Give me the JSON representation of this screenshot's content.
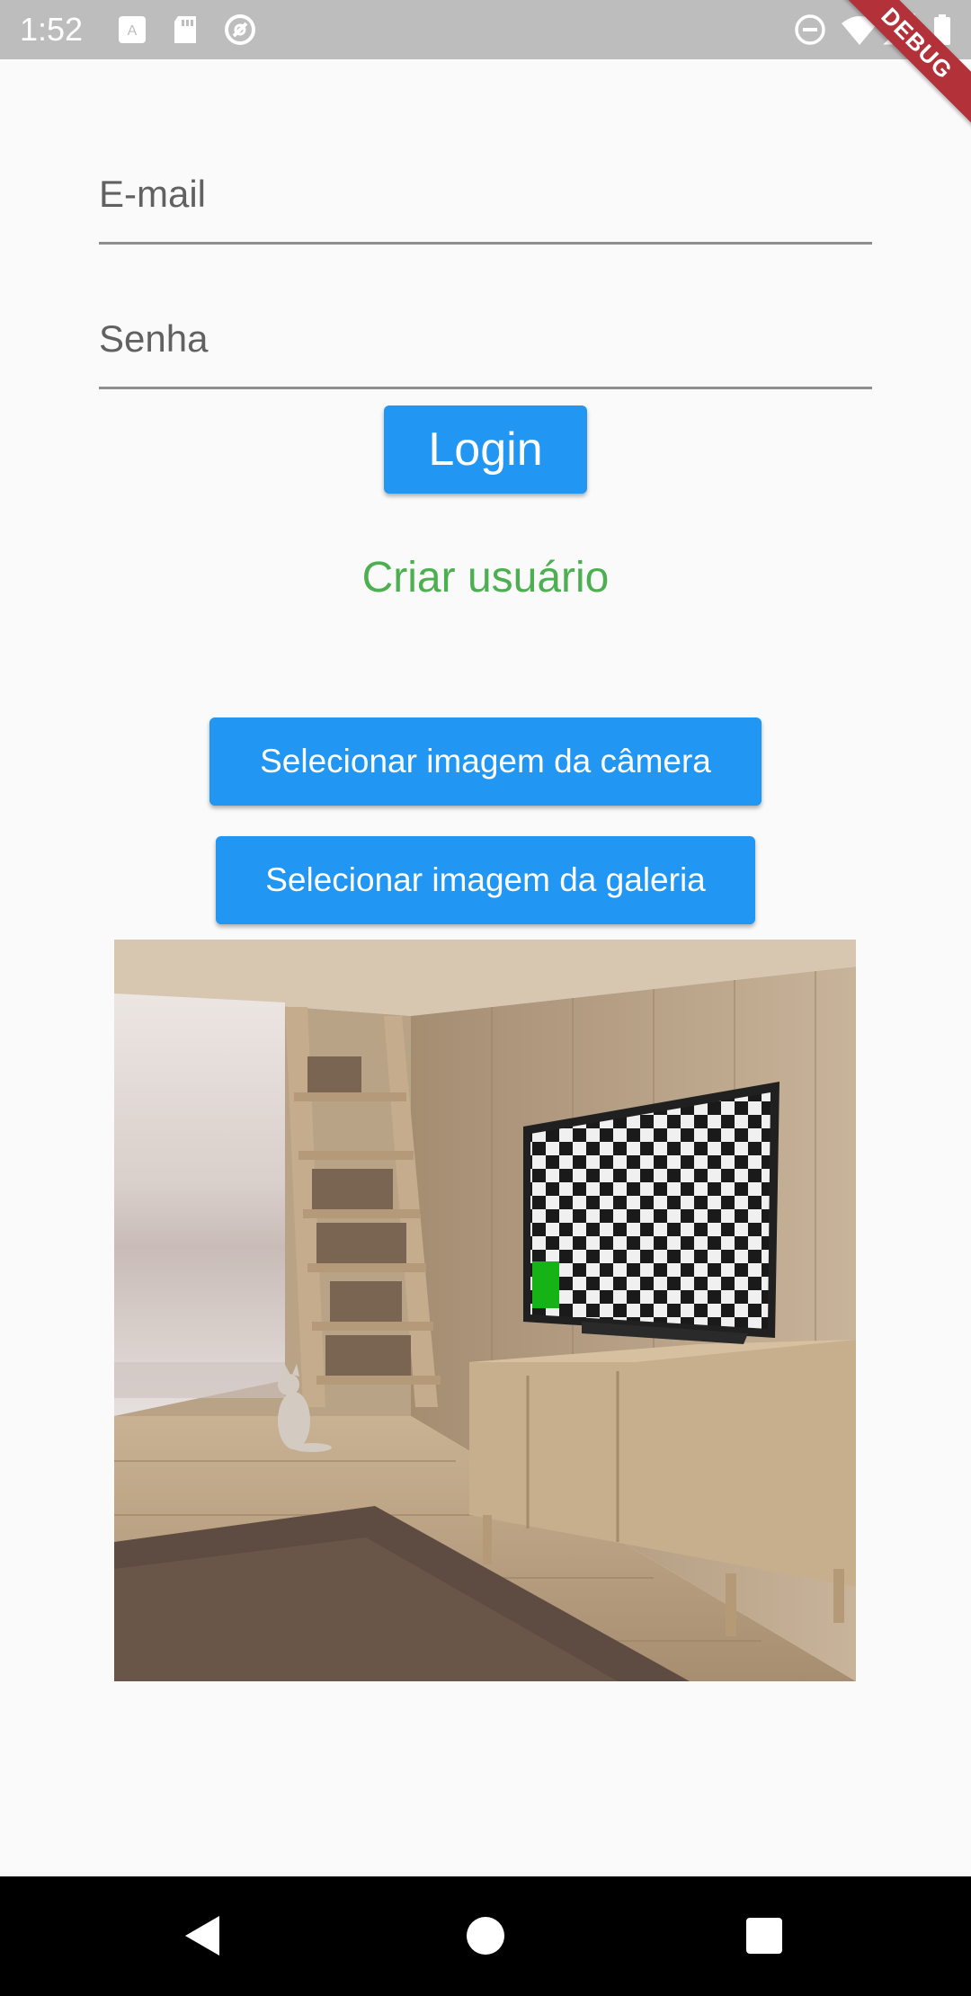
{
  "status_bar": {
    "time": "1:52",
    "left_icons": [
      "a-keyboard-icon",
      "sd-card-icon",
      "sync-circle-icon"
    ],
    "right_icons": [
      "do-not-disturb-icon",
      "wifi-icon",
      "cellular-icon",
      "battery-icon"
    ],
    "debug_label": "DEBUG"
  },
  "form": {
    "email_label": "E-mail",
    "email_value": "",
    "password_label": "Senha",
    "password_value": "",
    "login_label": "Login",
    "create_user_label": "Criar usuário"
  },
  "image_actions": {
    "camera_label": "Selecionar imagem da câmera",
    "gallery_label": "Selecionar imagem da galeria"
  },
  "picture": {
    "description_icon": "room-photo"
  },
  "nav_bar": {
    "icons": [
      "back-icon",
      "home-icon",
      "recents-icon"
    ]
  },
  "colors": {
    "primary": "#2196f3",
    "link": "#4caf50",
    "status_bar": "#bdbdbd",
    "debug_banner": "#b3323a"
  }
}
